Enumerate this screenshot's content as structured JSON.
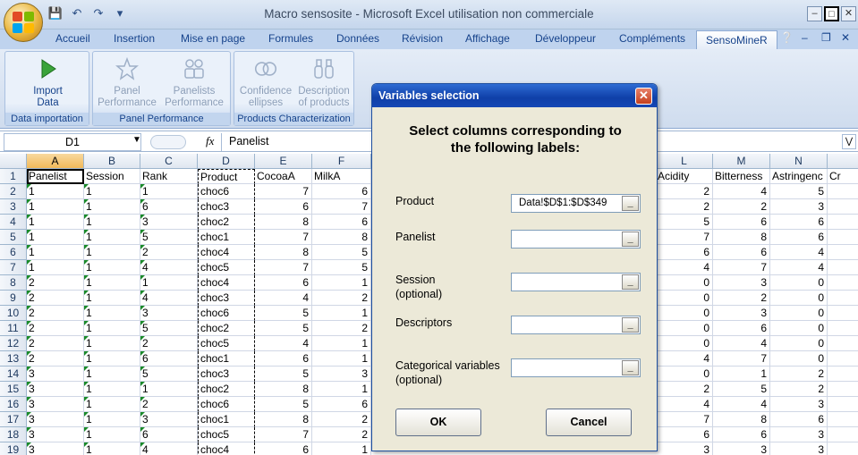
{
  "window": {
    "title": "Macro sensosite - Microsoft Excel utilisation non commerciale"
  },
  "ribbon_tabs": [
    "Accueil",
    "Insertion",
    "Mise en page",
    "Formules",
    "Données",
    "Révision",
    "Affichage",
    "Développeur",
    "Compléments",
    "SensoMineR"
  ],
  "selected_tab": "SensoMineR",
  "ribbon": {
    "import_data": "Import Data",
    "group_data_importation": "Data importation",
    "panel_performance": "Panel Performance",
    "panelists_performance": "Panelists Performance",
    "group_panel_performance": "Panel Performance",
    "confidence_ellipses": "Confidence ellipses",
    "description_of_products": "Description of products",
    "group_products_characterization": "Products Characterization"
  },
  "formula_bar": {
    "cell": "D1",
    "fx": "fx",
    "content": "Panelist"
  },
  "sheet": {
    "columns": [
      "A",
      "B",
      "C",
      "D",
      "E",
      "F",
      "L",
      "M",
      "N"
    ],
    "headers": {
      "A": "Panelist",
      "B": "Session",
      "C": "Rank",
      "D": "Product",
      "E": "CocoaA",
      "F": "MilkA",
      "L": "Acidity",
      "M": "Bitterness",
      "N": "Astringenc",
      "O": "Cr"
    },
    "rows": [
      {
        "n": "2",
        "A": "1",
        "B": "1",
        "C": "1",
        "D": "choc6",
        "E": "7",
        "F": "6",
        "L": "2",
        "M": "4",
        "N": "5"
      },
      {
        "n": "3",
        "A": "1",
        "B": "1",
        "C": "6",
        "D": "choc3",
        "E": "6",
        "F": "7",
        "L": "2",
        "M": "2",
        "N": "3"
      },
      {
        "n": "4",
        "A": "1",
        "B": "1",
        "C": "3",
        "D": "choc2",
        "E": "8",
        "F": "6",
        "L": "5",
        "M": "6",
        "N": "6"
      },
      {
        "n": "5",
        "A": "1",
        "B": "1",
        "C": "5",
        "D": "choc1",
        "E": "7",
        "F": "8",
        "L": "7",
        "M": "8",
        "N": "6"
      },
      {
        "n": "6",
        "A": "1",
        "B": "1",
        "C": "2",
        "D": "choc4",
        "E": "8",
        "F": "5",
        "L": "6",
        "M": "6",
        "N": "4"
      },
      {
        "n": "7",
        "A": "1",
        "B": "1",
        "C": "4",
        "D": "choc5",
        "E": "7",
        "F": "5",
        "L": "4",
        "M": "7",
        "N": "4"
      },
      {
        "n": "8",
        "A": "2",
        "B": "1",
        "C": "1",
        "D": "choc4",
        "E": "6",
        "F": "1",
        "L": "0",
        "M": "3",
        "N": "0"
      },
      {
        "n": "9",
        "A": "2",
        "B": "1",
        "C": "4",
        "D": "choc3",
        "E": "4",
        "F": "2",
        "L": "0",
        "M": "2",
        "N": "0"
      },
      {
        "n": "10",
        "A": "2",
        "B": "1",
        "C": "3",
        "D": "choc6",
        "E": "5",
        "F": "1",
        "L": "0",
        "M": "3",
        "N": "0"
      },
      {
        "n": "11",
        "A": "2",
        "B": "1",
        "C": "5",
        "D": "choc2",
        "E": "5",
        "F": "2",
        "L": "0",
        "M": "6",
        "N": "0"
      },
      {
        "n": "12",
        "A": "2",
        "B": "1",
        "C": "2",
        "D": "choc5",
        "E": "4",
        "F": "1",
        "L": "0",
        "M": "4",
        "N": "0"
      },
      {
        "n": "13",
        "A": "2",
        "B": "1",
        "C": "6",
        "D": "choc1",
        "E": "6",
        "F": "1",
        "L": "4",
        "M": "7",
        "N": "0"
      },
      {
        "n": "14",
        "A": "3",
        "B": "1",
        "C": "5",
        "D": "choc3",
        "E": "5",
        "F": "3",
        "L": "0",
        "M": "1",
        "N": "2"
      },
      {
        "n": "15",
        "A": "3",
        "B": "1",
        "C": "1",
        "D": "choc2",
        "E": "8",
        "F": "1",
        "L": "2",
        "M": "5",
        "N": "2"
      },
      {
        "n": "16",
        "A": "3",
        "B": "1",
        "C": "2",
        "D": "choc6",
        "E": "5",
        "F": "6",
        "L": "4",
        "M": "4",
        "N": "3"
      },
      {
        "n": "17",
        "A": "3",
        "B": "1",
        "C": "3",
        "D": "choc1",
        "E": "8",
        "F": "2",
        "L": "7",
        "M": "8",
        "N": "6"
      },
      {
        "n": "18",
        "A": "3",
        "B": "1",
        "C": "6",
        "D": "choc5",
        "E": "7",
        "F": "2",
        "L": "6",
        "M": "6",
        "N": "3"
      },
      {
        "n": "19",
        "A": "3",
        "B": "1",
        "C": "4",
        "D": "choc4",
        "E": "6",
        "F": "1",
        "L": "3",
        "M": "3",
        "N": "3"
      }
    ]
  },
  "dialog": {
    "title": "Variables selection",
    "heading_line1": "Select columns corresponding to",
    "heading_line2": "the following labels:",
    "product_label": "Product",
    "product_value": "Data!$D$1:$D$349",
    "panelist_label": "Panelist",
    "session_label": "Session",
    "session_optional": "(optional)",
    "descriptors_label": "Descriptors",
    "categorical_label": "Categorical variables",
    "categorical_optional": "(optional)",
    "ok": "OK",
    "cancel": "Cancel",
    "ref_button": "_"
  }
}
